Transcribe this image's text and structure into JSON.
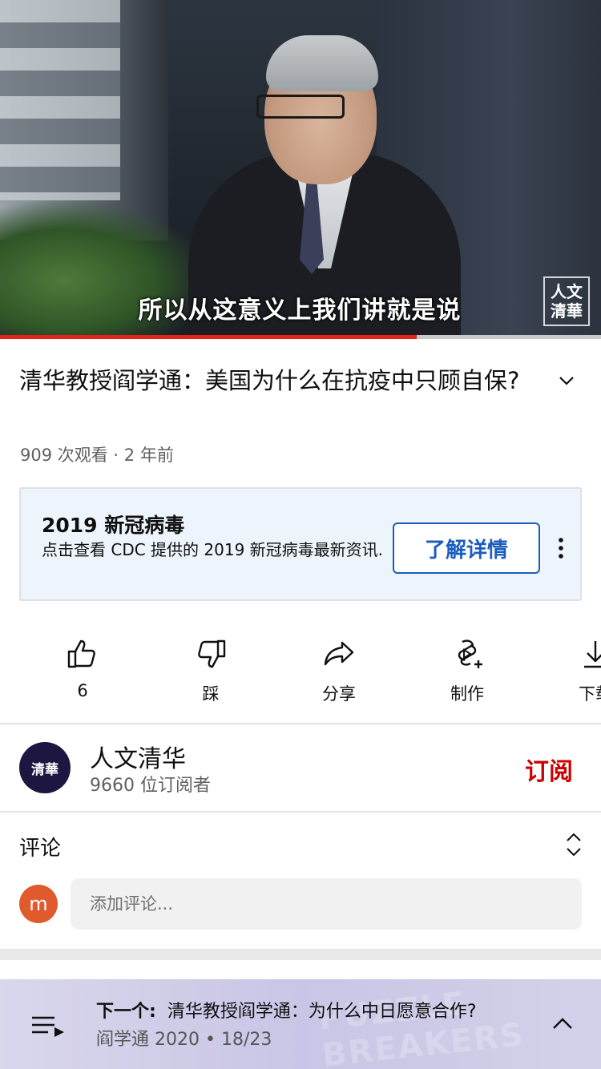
{
  "video": {
    "subtitle": "所以从这意义上我们讲就是说",
    "watermark": "人文\n清華",
    "progress": 0.693
  },
  "title": "清华教授阎学通：美国为什么在抗疫中只顾自保?",
  "meta": "909 次观看 · 2 年前",
  "info_panel": {
    "title": "2019 新冠病毒",
    "description": "点击查看 CDC 提供的 2019 新冠病毒最新资讯.",
    "button_label": "了解详情"
  },
  "actions": [
    {
      "label": "6",
      "icon": "thumbs-up-icon"
    },
    {
      "label": "踩",
      "icon": "thumbs-down-icon"
    },
    {
      "label": "分享",
      "icon": "share-icon"
    },
    {
      "label": "制作",
      "icon": "create-icon"
    },
    {
      "label": "下载",
      "icon": "download-icon"
    }
  ],
  "channel": {
    "avatar_text": "清華",
    "name": "人文清华",
    "subscribers": "9660 位订阅者",
    "subscribe_label": "订阅"
  },
  "comments": {
    "title": "评论",
    "user_initial": "m",
    "placeholder": "添加评论..."
  },
  "playlist": {
    "next_prefix": "下一个:",
    "next_title": "清华教授阎学通：为什么中日愿意合作?",
    "meta": "阎学通 2020 • 18/23",
    "art_text": "PUZZLE BREAKERS"
  },
  "colors": {
    "accent_red": "#cc0000",
    "progress_red": "#e1251b",
    "link_blue": "#1a5dbf",
    "panel_bg": "#eef4fb",
    "user_avatar": "#e15a2d"
  }
}
